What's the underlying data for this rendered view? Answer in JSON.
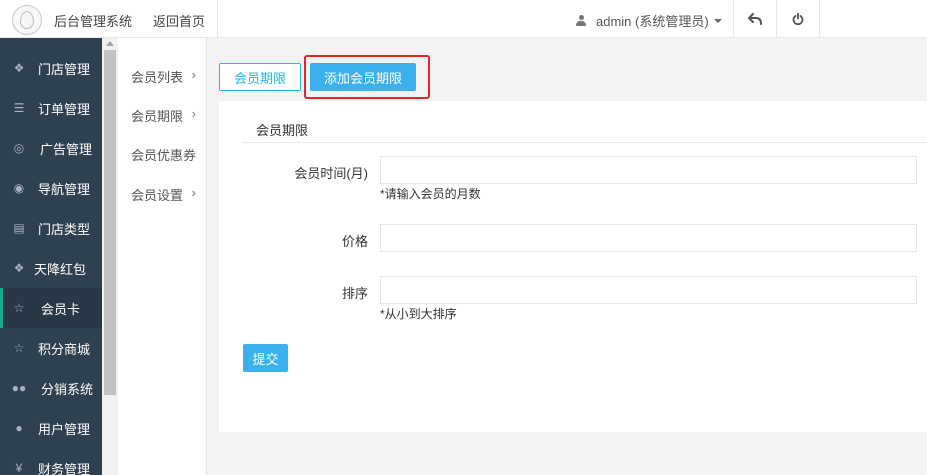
{
  "header": {
    "system_title": "后台管理系统",
    "back_home": "返回首页",
    "user_label": "admin (系统管理员)"
  },
  "sidebar": {
    "items": [
      {
        "label": "门店管理",
        "icon": "cubes-icon"
      },
      {
        "label": "订单管理",
        "icon": "list-icon"
      },
      {
        "label": "广告管理",
        "icon": "life-ring-icon"
      },
      {
        "label": "导航管理",
        "icon": "compass-icon"
      },
      {
        "label": "门店类型",
        "icon": "bank-icon"
      },
      {
        "label": "天降红包",
        "icon": "cubes-icon"
      },
      {
        "label": "会员卡",
        "icon": "star-icon"
      },
      {
        "label": "积分商城",
        "icon": "star-icon"
      },
      {
        "label": "分销系统",
        "icon": "users-icon"
      },
      {
        "label": "用户管理",
        "icon": "user-icon"
      },
      {
        "label": "财务管理",
        "icon": "yen-icon"
      }
    ],
    "active_index": 6
  },
  "submenu": {
    "items": [
      {
        "label": "会员列表",
        "has_chevron": true
      },
      {
        "label": "会员期限",
        "has_chevron": true
      },
      {
        "label": "会员优惠券",
        "has_chevron": false
      },
      {
        "label": "会员设置",
        "has_chevron": true
      }
    ]
  },
  "tabs": {
    "list_label": "会员期限",
    "add_label": "添加会员期限"
  },
  "panel": {
    "title": "会员期限"
  },
  "form": {
    "months_label": "会员时间(月)",
    "months_value": "",
    "months_hint": "*请输入会员的月数",
    "price_label": "价格",
    "price_value": "",
    "sort_label": "排序",
    "sort_value": "",
    "sort_hint": "*从小到大排序",
    "submit_label": "提交"
  },
  "colors": {
    "sidebar_bg": "#2f4050",
    "primary": "#3ab0ec",
    "highlight": "#e8232a"
  }
}
